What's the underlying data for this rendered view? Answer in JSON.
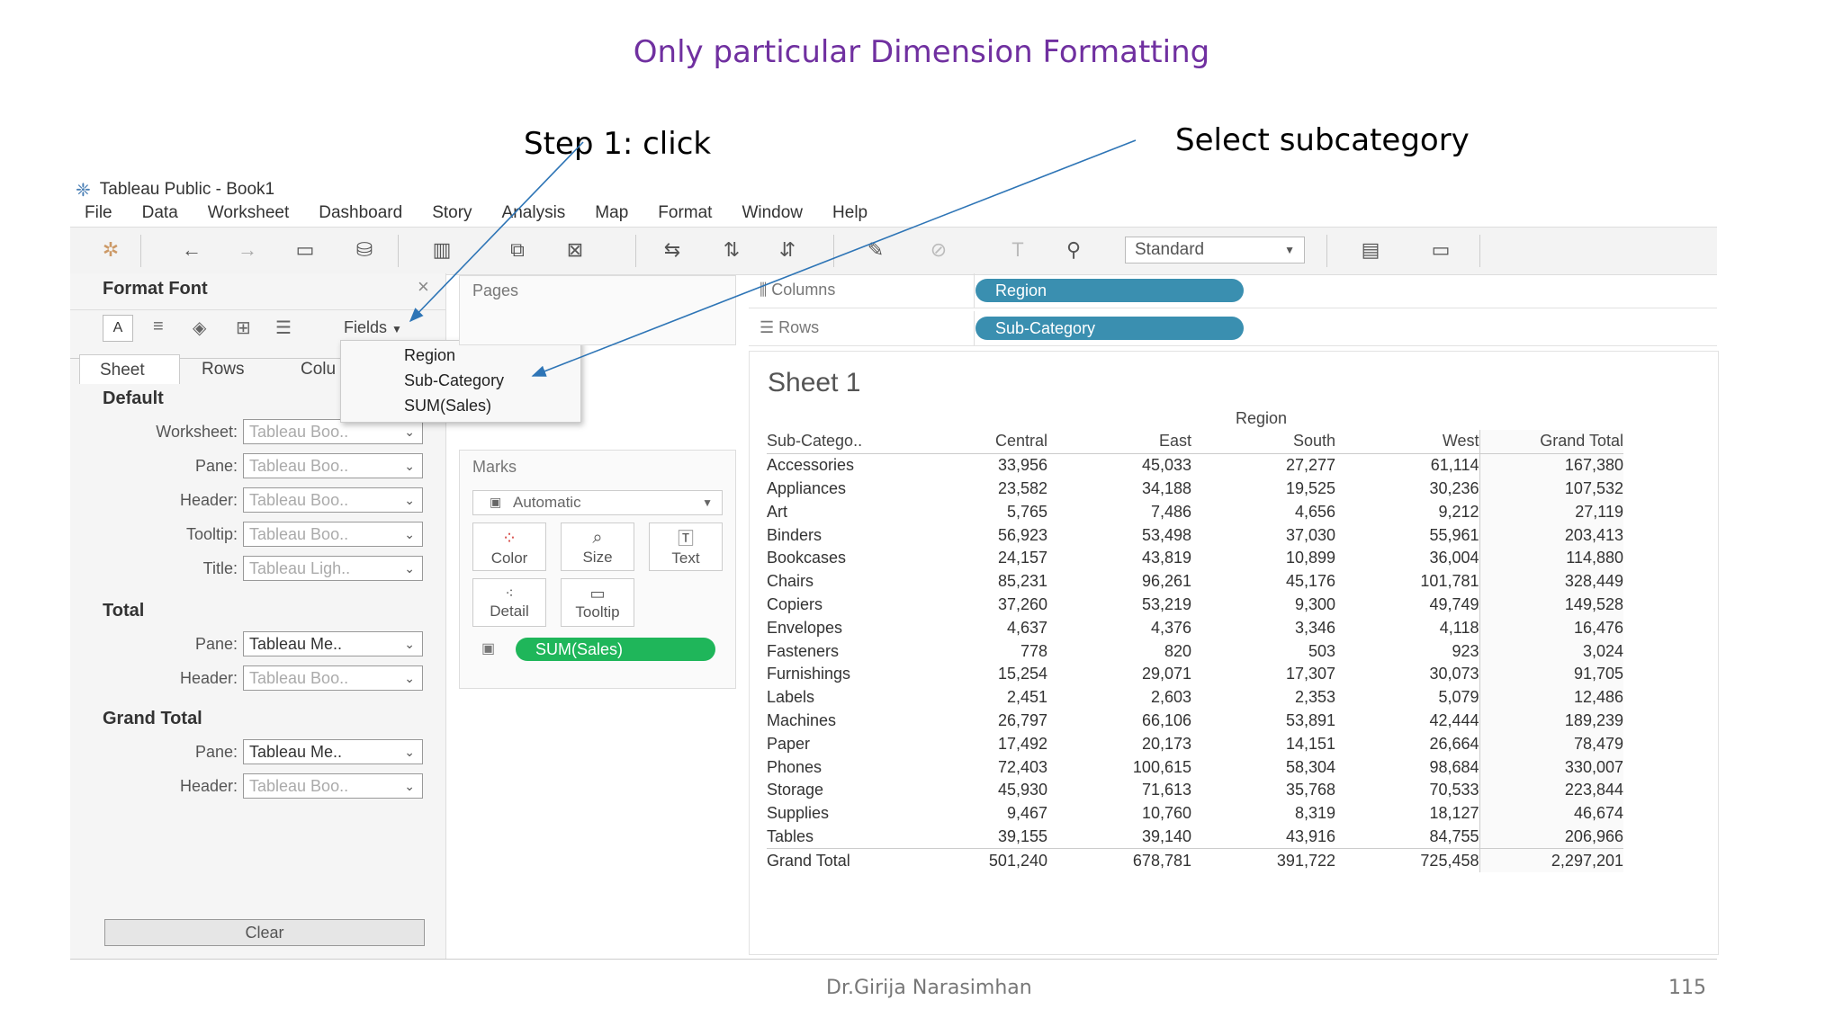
{
  "slide": {
    "title": "Only particular Dimension Formatting",
    "annotation_step1": "Step 1: click",
    "annotation_select": "Select subcategory",
    "footer_author": "Dr.Girija Narasimhan",
    "footer_page": "115"
  },
  "window": {
    "title": "Tableau Public - Book1",
    "menu": [
      "File",
      "Data",
      "Worksheet",
      "Dashboard",
      "Story",
      "Analysis",
      "Map",
      "Format",
      "Window",
      "Help"
    ],
    "toolbar_select": "Standard"
  },
  "format_pane": {
    "header": "Format Font",
    "close": "×",
    "fields_label": "Fields",
    "tabs": [
      "Sheet",
      "Rows",
      "Colu"
    ],
    "default_section": "Default",
    "default_rows": [
      {
        "label": "Worksheet:",
        "value": "Tableau Boo.."
      },
      {
        "label": "Pane:",
        "value": "Tableau Boo.."
      },
      {
        "label": "Header:",
        "value": "Tableau Boo.."
      },
      {
        "label": "Tooltip:",
        "value": "Tableau Boo.."
      },
      {
        "label": "Title:",
        "value": "Tableau Ligh.."
      }
    ],
    "total_section": "Total",
    "total_rows": [
      {
        "label": "Pane:",
        "value": "Tableau Me.."
      },
      {
        "label": "Header:",
        "value": "Tableau Boo.."
      }
    ],
    "grand_total_section": "Grand Total",
    "grand_total_rows": [
      {
        "label": "Pane:",
        "value": "Tableau Me.."
      },
      {
        "label": "Header:",
        "value": "Tableau Boo.."
      }
    ],
    "clear_label": "Clear",
    "fields_menu": [
      "Region",
      "Sub-Category",
      "SUM(Sales)"
    ]
  },
  "cards": {
    "pages": "Pages",
    "marks": "Marks",
    "mark_type": "Automatic",
    "mark_buttons": [
      "Color",
      "Size",
      "Text",
      "Detail",
      "Tooltip"
    ],
    "mark_pill": "SUM(Sales)"
  },
  "shelves": {
    "columns_label": "Columns",
    "columns_pill": "Region",
    "rows_label": "Rows",
    "rows_pill": "Sub-Category"
  },
  "view": {
    "sheet_title": "Sheet 1",
    "column_group": "Region",
    "headers": [
      "Sub-Catego..",
      "Central",
      "East",
      "South",
      "West",
      "Grand Total"
    ],
    "rows": [
      [
        "Accessories",
        "33,956",
        "45,033",
        "27,277",
        "61,114",
        "167,380"
      ],
      [
        "Appliances",
        "23,582",
        "34,188",
        "19,525",
        "30,236",
        "107,532"
      ],
      [
        "Art",
        "5,765",
        "7,486",
        "4,656",
        "9,212",
        "27,119"
      ],
      [
        "Binders",
        "56,923",
        "53,498",
        "37,030",
        "55,961",
        "203,413"
      ],
      [
        "Bookcases",
        "24,157",
        "43,819",
        "10,899",
        "36,004",
        "114,880"
      ],
      [
        "Chairs",
        "85,231",
        "96,261",
        "45,176",
        "101,781",
        "328,449"
      ],
      [
        "Copiers",
        "37,260",
        "53,219",
        "9,300",
        "49,749",
        "149,528"
      ],
      [
        "Envelopes",
        "4,637",
        "4,376",
        "3,346",
        "4,118",
        "16,476"
      ],
      [
        "Fasteners",
        "778",
        "820",
        "503",
        "923",
        "3,024"
      ],
      [
        "Furnishings",
        "15,254",
        "29,071",
        "17,307",
        "30,073",
        "91,705"
      ],
      [
        "Labels",
        "2,451",
        "2,603",
        "2,353",
        "5,079",
        "12,486"
      ],
      [
        "Machines",
        "26,797",
        "66,106",
        "53,891",
        "42,444",
        "189,239"
      ],
      [
        "Paper",
        "17,492",
        "20,173",
        "14,151",
        "26,664",
        "78,479"
      ],
      [
        "Phones",
        "72,403",
        "100,615",
        "58,304",
        "98,684",
        "330,007"
      ],
      [
        "Storage",
        "45,930",
        "71,613",
        "35,768",
        "70,533",
        "223,844"
      ],
      [
        "Supplies",
        "9,467",
        "10,760",
        "8,319",
        "18,127",
        "46,674"
      ],
      [
        "Tables",
        "39,155",
        "39,140",
        "43,916",
        "84,755",
        "206,966"
      ]
    ],
    "total_row": [
      "Grand Total",
      "501,240",
      "678,781",
      "391,722",
      "725,458",
      "2,297,201"
    ]
  },
  "colors": {
    "title": "#7030a0",
    "pill_blue": "#3a8fb0",
    "pill_green": "#1fb65a",
    "arrow": "#2e75b6"
  }
}
